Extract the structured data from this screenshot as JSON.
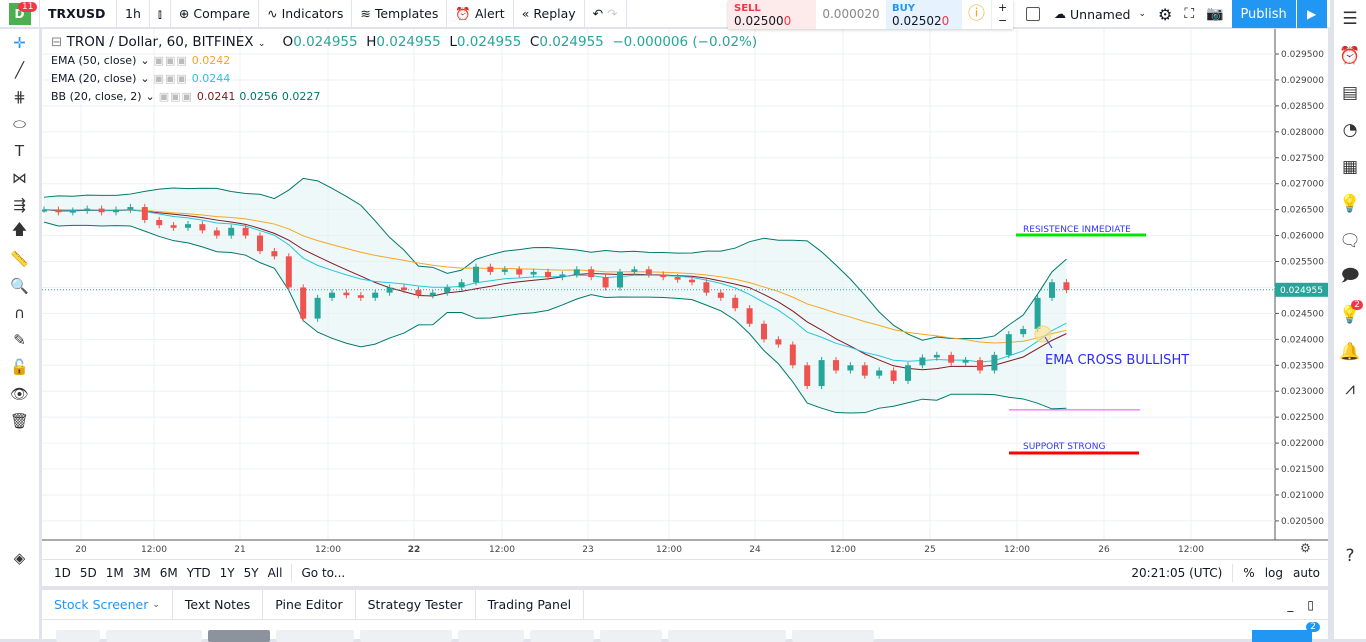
{
  "topbar": {
    "notif_count": "11",
    "logo_letter": "D",
    "symbol": "TRXUSD",
    "interval": "1h",
    "compare": "Compare",
    "indicators": "Indicators",
    "templates": "Templates",
    "alert": "Alert",
    "replay": "Replay",
    "layout_name": "Unnamed",
    "publish": "Publish"
  },
  "trade": {
    "sell_label": "SELL",
    "sell_price": "0.02500",
    "sell_last": "0",
    "spread": "0.000020",
    "buy_label": "BUY",
    "buy_price": "0.02502",
    "buy_last": "0"
  },
  "legend": {
    "title": "TRON / Dollar, 60, BITFINEX",
    "o_label": "O",
    "o": "0.024955",
    "h_label": "H",
    "h": "0.024955",
    "l_label": "L",
    "l": "0.024955",
    "c_label": "C",
    "c": "0.024955",
    "change": "−0.000006 (−0.02%)"
  },
  "indicators": [
    {
      "name": "EMA (50, close)",
      "values": [
        "0.0242"
      ],
      "colors": [
        "#f5a623"
      ]
    },
    {
      "name": "EMA (20, close)",
      "values": [
        "0.0244"
      ],
      "colors": [
        "#26c6da"
      ]
    },
    {
      "name": "BB (20, close, 2)",
      "values": [
        "0.0241",
        "0.0256",
        "0.0227"
      ],
      "colors": [
        "#801922",
        "#00796b",
        "#00796b"
      ]
    }
  ],
  "chart_data": {
    "type": "candlestick",
    "symbol": "TRXUSD",
    "interval": "60",
    "ylim": [
      0.0203,
      0.0298
    ],
    "price_ticks": [
      "0.029500",
      "0.029000",
      "0.028500",
      "0.028000",
      "0.027500",
      "0.027000",
      "0.026500",
      "0.026000",
      "0.025500",
      "0.025000",
      "0.024500",
      "0.024000",
      "0.023500",
      "0.023000",
      "0.022500",
      "0.022000",
      "0.021500",
      "0.021000",
      "0.020500"
    ],
    "last_price": "0.024955",
    "time_ticks": [
      "20",
      "12:00",
      "21",
      "12:00",
      "22",
      "12:00",
      "23",
      "12:00",
      "24",
      "12:00",
      "25",
      "12:00",
      "26",
      "12:00"
    ],
    "closes": [
      0.0265,
      0.02645,
      0.02648,
      0.02652,
      0.02645,
      0.0265,
      0.02655,
      0.0263,
      0.0262,
      0.02615,
      0.02622,
      0.0261,
      0.026,
      0.02615,
      0.026,
      0.0257,
      0.0256,
      0.025,
      0.0244,
      0.0248,
      0.0249,
      0.02485,
      0.0248,
      0.0249,
      0.025,
      0.02495,
      0.02485,
      0.0249,
      0.025,
      0.0251,
      0.0254,
      0.0253,
      0.02535,
      0.02525,
      0.0253,
      0.0252,
      0.02525,
      0.02535,
      0.0252,
      0.025,
      0.0253,
      0.02535,
      0.02525,
      0.0252,
      0.02515,
      0.0251,
      0.0249,
      0.0248,
      0.0246,
      0.0243,
      0.024,
      0.0239,
      0.0235,
      0.0231,
      0.0236,
      0.0234,
      0.0235,
      0.0233,
      0.0234,
      0.0232,
      0.0235,
      0.02365,
      0.0237,
      0.02355,
      0.0236,
      0.0234,
      0.0237,
      0.0241,
      0.0242,
      0.0248,
      0.0251,
      0.02495
    ],
    "annotations": [
      {
        "text": "RESISTENCE INMEDIATE",
        "price": 0.02601,
        "color": "#00e600"
      },
      {
        "text": "EMA CROSS BULLISHT",
        "price": 0.02375,
        "color": "#2a2aff"
      },
      {
        "text": "SUPPORT STRONG",
        "price": 0.02181,
        "color": "#ff0000"
      }
    ],
    "support_line_magenta": 0.02264
  },
  "rangebar": {
    "ranges": [
      "1D",
      "5D",
      "1M",
      "3M",
      "6M",
      "YTD",
      "1Y",
      "5Y",
      "All"
    ],
    "goto": "Go to...",
    "time": "20:21:05 (UTC)",
    "pct": "%",
    "log": "log",
    "auto": "auto"
  },
  "panel": {
    "tabs": [
      "Stock Screener",
      "Text Notes",
      "Pine Editor",
      "Strategy Tester",
      "Trading Panel"
    ],
    "filter_badge": "2"
  },
  "rightbar": {
    "ideas_badge": "2"
  }
}
